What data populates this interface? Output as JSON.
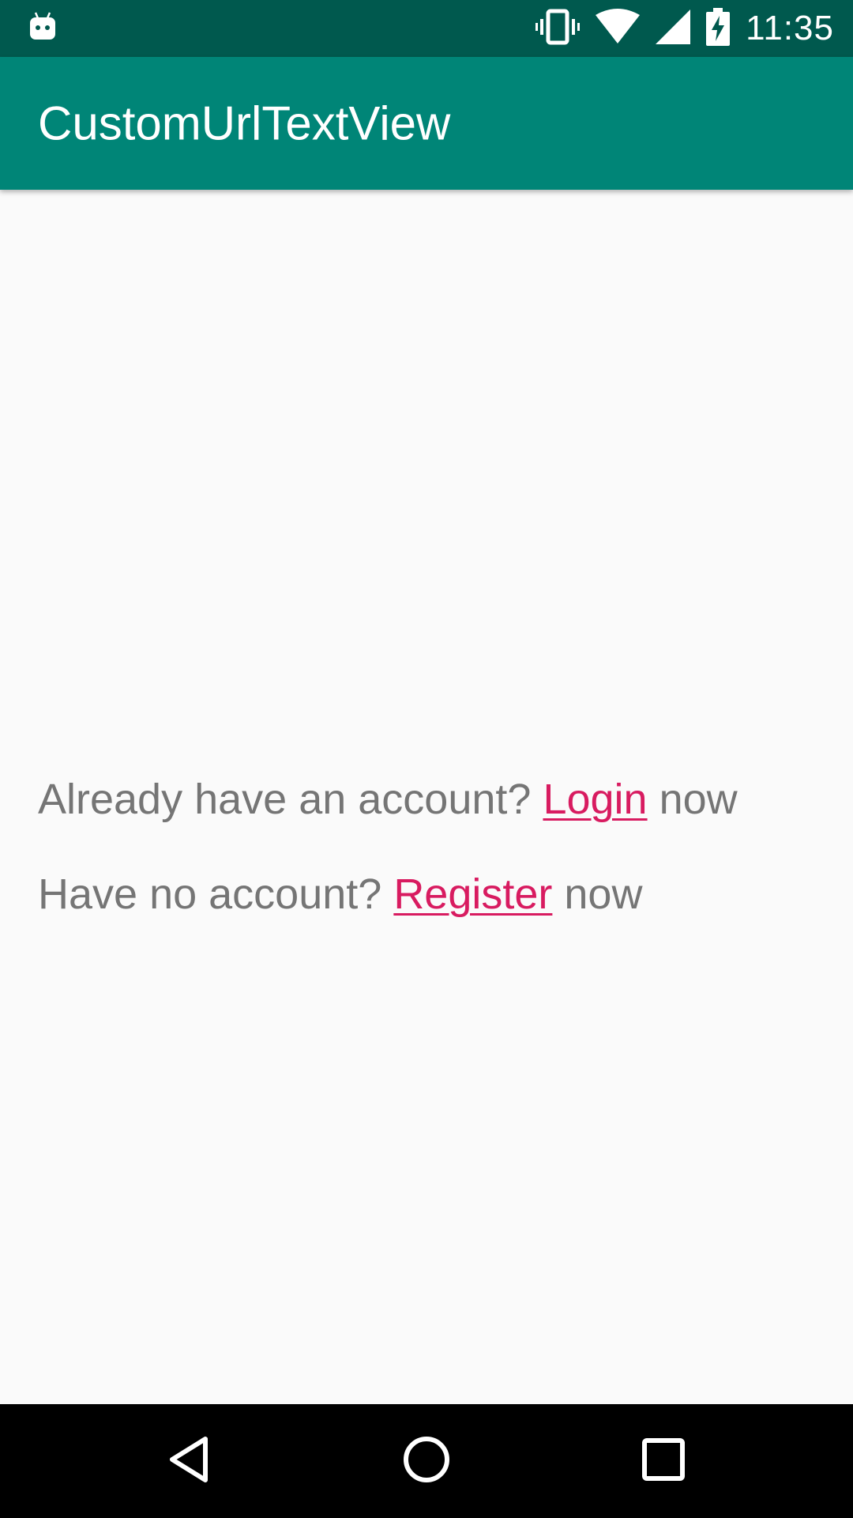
{
  "status_bar": {
    "time": "11:35",
    "icons": [
      "android-debug-icon",
      "vibrate-icon",
      "wifi-icon",
      "signal-icon",
      "battery-charging-icon"
    ]
  },
  "app_bar": {
    "title": "CustomUrlTextView"
  },
  "content": {
    "line1": {
      "prefix": "Already have an account? ",
      "link": "Login",
      "suffix": " now"
    },
    "line2": {
      "prefix": "Have no account? ",
      "link": "Register",
      "suffix": " now"
    }
  },
  "nav_bar": {
    "icons": [
      "back-icon",
      "home-icon",
      "recents-icon"
    ]
  },
  "colors": {
    "status_bar": "#00594e",
    "app_bar": "#008577",
    "link": "#d81b60",
    "body_text": "#757575",
    "background": "#fafafa"
  }
}
